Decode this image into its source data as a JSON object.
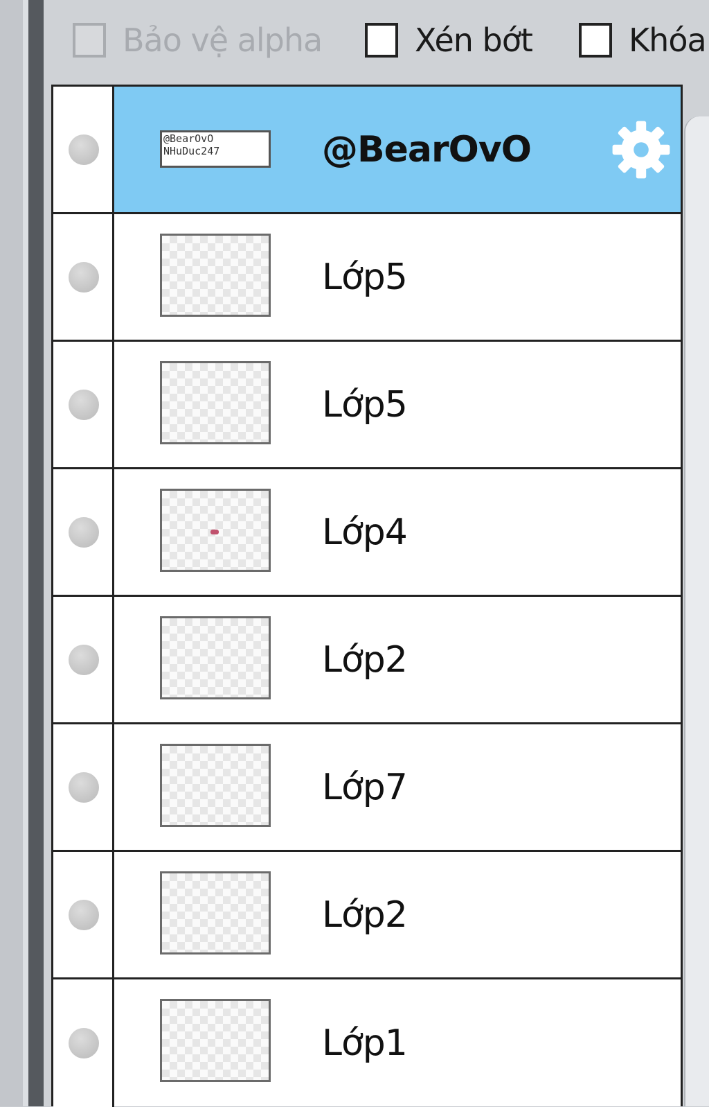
{
  "options": {
    "protect_alpha_label": "Bảo vệ alpha",
    "clip_label": "Xén bớt",
    "lock_label": "Khóa"
  },
  "layers": [
    {
      "name": "@BearOvO",
      "thumb_lines": [
        "@BearOvO",
        "NHuDuc247"
      ],
      "selected": true
    },
    {
      "name": "Lớp5"
    },
    {
      "name": "Lớp5"
    },
    {
      "name": "Lớp4"
    },
    {
      "name": "Lớp2"
    },
    {
      "name": "Lớp7"
    },
    {
      "name": "Lớp2"
    },
    {
      "name": "Lớp1"
    }
  ],
  "colors": {
    "selected_row": "#7fcaf3",
    "gear_icon": "#ffffff"
  },
  "icons": {
    "visibility": "visibility-dot-icon",
    "settings": "gear-icon"
  }
}
